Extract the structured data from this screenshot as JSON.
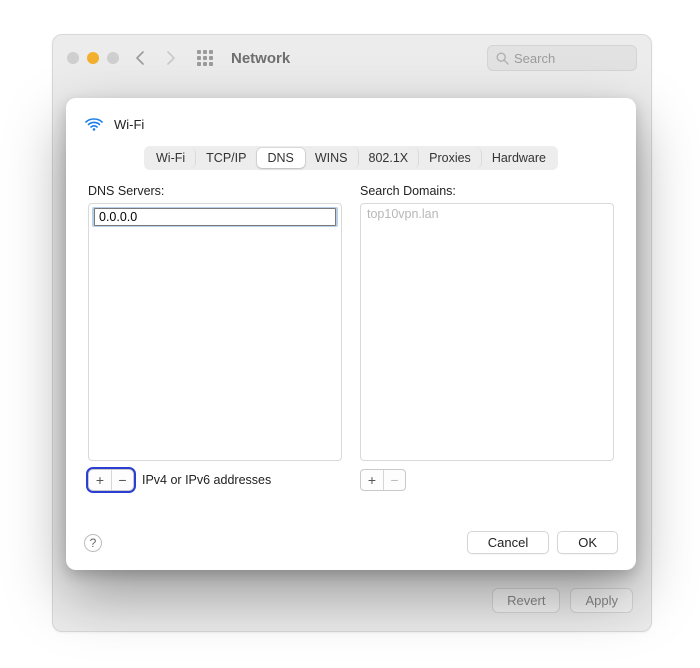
{
  "background": {
    "title": "Network",
    "search_placeholder": "Search",
    "buttons": {
      "revert": "Revert",
      "apply": "Apply"
    }
  },
  "sheet": {
    "title": "Wi-Fi",
    "tabs": [
      "Wi-Fi",
      "TCP/IP",
      "DNS",
      "WINS",
      "802.1X",
      "Proxies",
      "Hardware"
    ],
    "active_tab_index": 2,
    "dns": {
      "label": "DNS Servers:",
      "entry_value": "0.0.0.0",
      "hint": "IPv4 or IPv6 addresses"
    },
    "domains": {
      "label": "Search Domains:",
      "items": [
        "top10vpn.lan"
      ]
    },
    "footer": {
      "help": "?",
      "cancel": "Cancel",
      "ok": "OK"
    },
    "glyphs": {
      "plus": "+",
      "minus": "−"
    }
  }
}
